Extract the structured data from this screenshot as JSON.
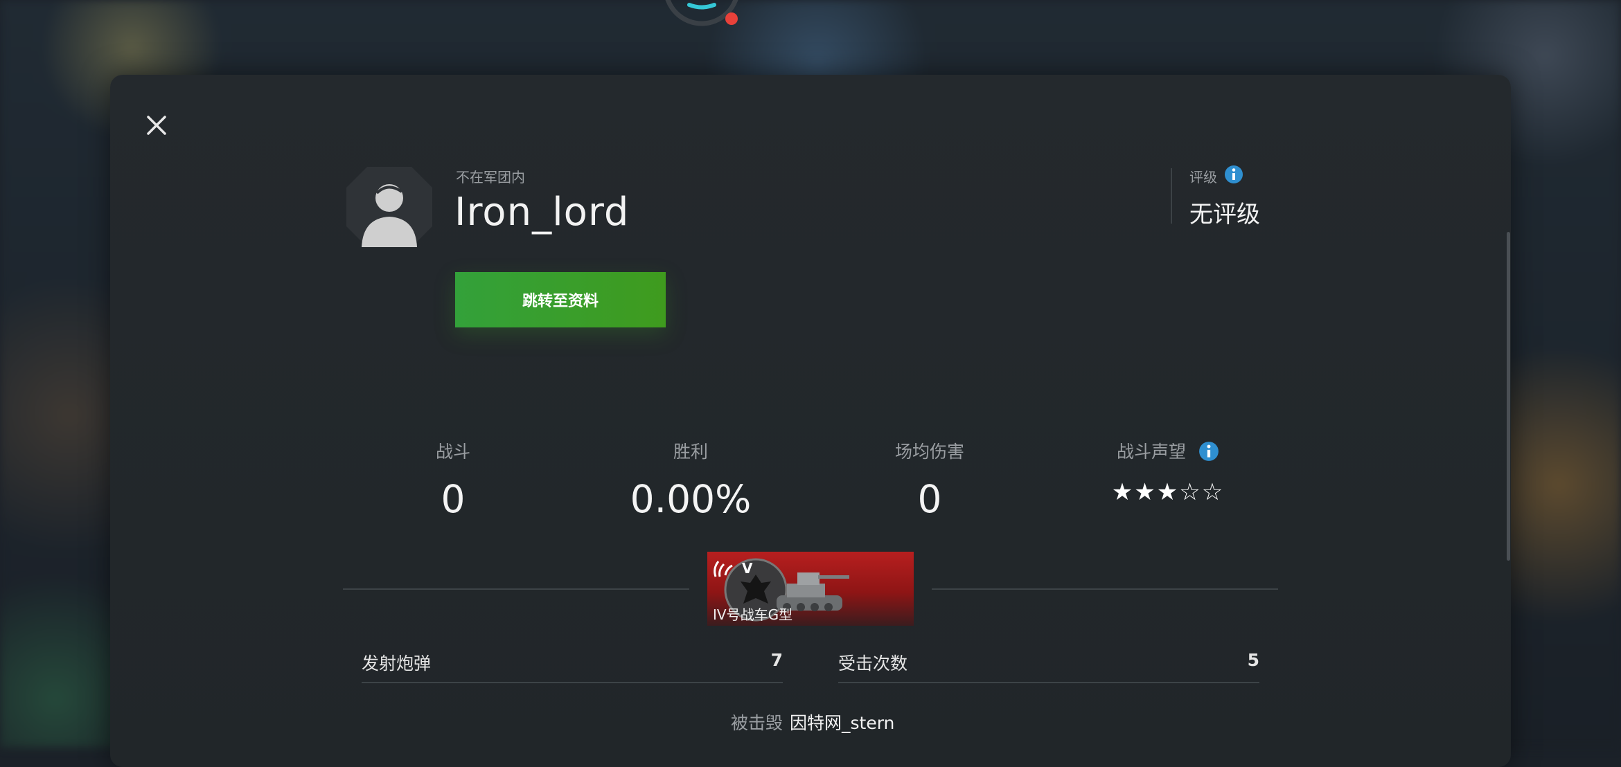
{
  "player": {
    "clan_status": "不在军团内",
    "name": "Iron_lord",
    "goto_profile_label": "跳转至资料"
  },
  "rating": {
    "label": "评级",
    "value": "无评级"
  },
  "stats": [
    {
      "label": "战斗",
      "value": "0"
    },
    {
      "label": "胜利",
      "value": "0.00%"
    },
    {
      "label": "场均伤害",
      "value": "0"
    },
    {
      "label": "战斗声望",
      "stars_text": "★★★☆☆",
      "stars_filled": 3,
      "stars_total": 5
    }
  ],
  "vehicle": {
    "tier": "V",
    "name": "IV号战车G型"
  },
  "battle_rows": [
    {
      "label": "发射炮弹",
      "value": "7"
    },
    {
      "label": "受击次数",
      "value": "5"
    }
  ],
  "destroyed": {
    "label": "被击毁",
    "by": "因特网_stern"
  },
  "colors": {
    "accent_green": "#3a9e2a",
    "info_blue": "#2f8fd0",
    "tank_card_red": "#b71f1f",
    "status_dot_red": "#e8413a"
  },
  "icons": {
    "close": "close-icon",
    "info": "info-icon",
    "avatar": "default-avatar-icon",
    "nation": "germany-eagle-icon"
  }
}
